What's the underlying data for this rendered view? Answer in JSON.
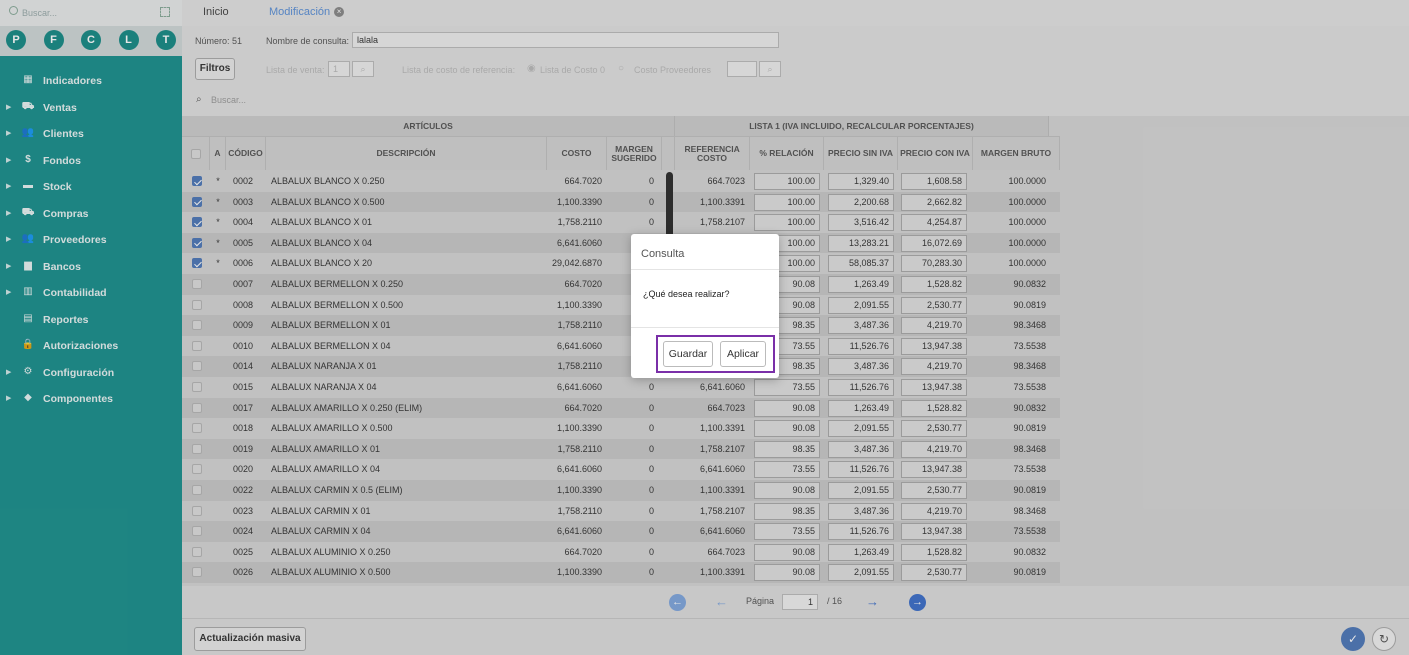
{
  "sidebar": {
    "search_placeholder": "Buscar...",
    "shortcuts": [
      "P",
      "F",
      "C",
      "L",
      "T"
    ],
    "items": [
      {
        "label": "Indicadores",
        "icon": "dashboard-icon",
        "glyph": "▦",
        "expandable": false
      },
      {
        "label": "Ventas",
        "icon": "cart-icon",
        "glyph": "⛟",
        "expandable": true
      },
      {
        "label": "Clientes",
        "icon": "users-icon",
        "glyph": "👥",
        "expandable": true
      },
      {
        "label": "Fondos",
        "icon": "dollar-icon",
        "glyph": "$",
        "expandable": true
      },
      {
        "label": "Stock",
        "icon": "box-icon",
        "glyph": "▬",
        "expandable": true
      },
      {
        "label": "Compras",
        "icon": "purchase-cart-icon",
        "glyph": "⛟",
        "expandable": true
      },
      {
        "label": "Proveedores",
        "icon": "suppliers-icon",
        "glyph": "👥",
        "expandable": true
      },
      {
        "label": "Bancos",
        "icon": "bank-icon",
        "glyph": "▆",
        "expandable": true
      },
      {
        "label": "Contabilidad",
        "icon": "ledger-icon",
        "glyph": "▥",
        "expandable": true
      },
      {
        "label": "Reportes",
        "icon": "report-icon",
        "glyph": "▤",
        "expandable": false
      },
      {
        "label": "Autorizaciones",
        "icon": "lock-icon",
        "glyph": "🔒",
        "expandable": false
      },
      {
        "label": "Configuración",
        "icon": "gears-icon",
        "glyph": "⚙",
        "expandable": true
      },
      {
        "label": "Componentes",
        "icon": "puzzle-icon",
        "glyph": "◆",
        "expandable": true
      }
    ]
  },
  "tabs": [
    {
      "label": "Inicio",
      "active": false
    },
    {
      "label": "Modificación",
      "active": true
    }
  ],
  "form": {
    "numero_label": "Número: 51",
    "nombre_label": "Nombre de consulta:",
    "nombre_value": "lalala",
    "filtros_label": "Filtros",
    "lista_venta_label": "Lista de venta:",
    "lista_venta_value": "1",
    "lista_costo_label": "Lista de costo de referencia:",
    "opt_lista_costo": "Lista de Costo 0",
    "opt_costo_prov": "Costo Proveedores",
    "search_placeholder": "Buscar..."
  },
  "table": {
    "group_articulos": "ARTÍCULOS",
    "group_lista": "LISTA 1 (IVA INCLUIDO, RECALCULAR PORCENTAJES)",
    "headers": {
      "a": "A",
      "codigo": "CÓDIGO",
      "descripcion": "DESCRIPCIÓN",
      "costo": "COSTO",
      "margen": "MARGEN SUGERIDO",
      "referencia": "REFERENCIA COSTO",
      "relacion": "% RELACIÓN",
      "sin_iva": "PRECIO SIN IVA",
      "con_iva": "PRECIO CON IVA",
      "margen_bruto": "MARGEN BRUTO"
    },
    "rows": [
      {
        "checked": true,
        "a": "*",
        "codigo": "0002",
        "desc": "ALBALUX BLANCO X 0.250",
        "costo": "664.7020",
        "margen": "0",
        "ref": "664.7023",
        "rel": "100.00",
        "siniva": "1,329.40",
        "coniva": "1,608.58",
        "mb": "100.0000"
      },
      {
        "checked": true,
        "a": "*",
        "codigo": "0003",
        "desc": "ALBALUX BLANCO X 0.500",
        "costo": "1,100.3390",
        "margen": "0",
        "ref": "1,100.3391",
        "rel": "100.00",
        "siniva": "2,200.68",
        "coniva": "2,662.82",
        "mb": "100.0000"
      },
      {
        "checked": true,
        "a": "*",
        "codigo": "0004",
        "desc": "ALBALUX BLANCO X 01",
        "costo": "1,758.2110",
        "margen": "0",
        "ref": "1,758.2107",
        "rel": "100.00",
        "siniva": "3,516.42",
        "coniva": "4,254.87",
        "mb": "100.0000"
      },
      {
        "checked": true,
        "a": "*",
        "codigo": "0005",
        "desc": "ALBALUX BLANCO X 04",
        "costo": "6,641.6060",
        "margen": "",
        "ref": "",
        "rel": "100.00",
        "siniva": "13,283.21",
        "coniva": "16,072.69",
        "mb": "100.0000"
      },
      {
        "checked": true,
        "a": "*",
        "codigo": "0006",
        "desc": "ALBALUX BLANCO X 20",
        "costo": "29,042.6870",
        "margen": "",
        "ref": "",
        "rel": "100.00",
        "siniva": "58,085.37",
        "coniva": "70,283.30",
        "mb": "100.0000"
      },
      {
        "checked": false,
        "a": "",
        "codigo": "0007",
        "desc": "ALBALUX BERMELLON X 0.250",
        "costo": "664.7020",
        "margen": "",
        "ref": "",
        "rel": "90.08",
        "siniva": "1,263.49",
        "coniva": "1,528.82",
        "mb": "90.0832"
      },
      {
        "checked": false,
        "a": "",
        "codigo": "0008",
        "desc": "ALBALUX BERMELLON X 0.500",
        "costo": "1,100.3390",
        "margen": "",
        "ref": "",
        "rel": "90.08",
        "siniva": "2,091.55",
        "coniva": "2,530.77",
        "mb": "90.0819"
      },
      {
        "checked": false,
        "a": "",
        "codigo": "0009",
        "desc": "ALBALUX BERMELLON X 01",
        "costo": "1,758.2110",
        "margen": "",
        "ref": "",
        "rel": "98.35",
        "siniva": "3,487.36",
        "coniva": "4,219.70",
        "mb": "98.3468"
      },
      {
        "checked": false,
        "a": "",
        "codigo": "0010",
        "desc": "ALBALUX BERMELLON X 04",
        "costo": "6,641.6060",
        "margen": "",
        "ref": "",
        "rel": "73.55",
        "siniva": "11,526.76",
        "coniva": "13,947.38",
        "mb": "73.5538"
      },
      {
        "checked": false,
        "a": "",
        "codigo": "0014",
        "desc": "ALBALUX NARANJA X 01",
        "costo": "1,758.2110",
        "margen": "",
        "ref": "",
        "rel": "98.35",
        "siniva": "3,487.36",
        "coniva": "4,219.70",
        "mb": "98.3468"
      },
      {
        "checked": false,
        "a": "",
        "codigo": "0015",
        "desc": "ALBALUX NARANJA X 04",
        "costo": "6,641.6060",
        "margen": "0",
        "ref": "6,641.6060",
        "rel": "73.55",
        "siniva": "11,526.76",
        "coniva": "13,947.38",
        "mb": "73.5538"
      },
      {
        "checked": false,
        "a": "",
        "codigo": "0017",
        "desc": "ALBALUX AMARILLO X 0.250 (ELIM)",
        "costo": "664.7020",
        "margen": "0",
        "ref": "664.7023",
        "rel": "90.08",
        "siniva": "1,263.49",
        "coniva": "1,528.82",
        "mb": "90.0832"
      },
      {
        "checked": false,
        "a": "",
        "codigo": "0018",
        "desc": "ALBALUX AMARILLO X 0.500",
        "costo": "1,100.3390",
        "margen": "0",
        "ref": "1,100.3391",
        "rel": "90.08",
        "siniva": "2,091.55",
        "coniva": "2,530.77",
        "mb": "90.0819"
      },
      {
        "checked": false,
        "a": "",
        "codigo": "0019",
        "desc": "ALBALUX AMARILLO X 01",
        "costo": "1,758.2110",
        "margen": "0",
        "ref": "1,758.2107",
        "rel": "98.35",
        "siniva": "3,487.36",
        "coniva": "4,219.70",
        "mb": "98.3468"
      },
      {
        "checked": false,
        "a": "",
        "codigo": "0020",
        "desc": "ALBALUX AMARILLO X 04",
        "costo": "6,641.6060",
        "margen": "0",
        "ref": "6,641.6060",
        "rel": "73.55",
        "siniva": "11,526.76",
        "coniva": "13,947.38",
        "mb": "73.5538"
      },
      {
        "checked": false,
        "a": "",
        "codigo": "0022",
        "desc": "ALBALUX CARMIN X 0.5 (ELIM)",
        "costo": "1,100.3390",
        "margen": "0",
        "ref": "1,100.3391",
        "rel": "90.08",
        "siniva": "2,091.55",
        "coniva": "2,530.77",
        "mb": "90.0819"
      },
      {
        "checked": false,
        "a": "",
        "codigo": "0023",
        "desc": "ALBALUX CARMIN X 01",
        "costo": "1,758.2110",
        "margen": "0",
        "ref": "1,758.2107",
        "rel": "98.35",
        "siniva": "3,487.36",
        "coniva": "4,219.70",
        "mb": "98.3468"
      },
      {
        "checked": false,
        "a": "",
        "codigo": "0024",
        "desc": "ALBALUX CARMIN X 04",
        "costo": "6,641.6060",
        "margen": "0",
        "ref": "6,641.6060",
        "rel": "73.55",
        "siniva": "11,526.76",
        "coniva": "13,947.38",
        "mb": "73.5538"
      },
      {
        "checked": false,
        "a": "",
        "codigo": "0025",
        "desc": "ALBALUX ALUMINIO X 0.250",
        "costo": "664.7020",
        "margen": "0",
        "ref": "664.7023",
        "rel": "90.08",
        "siniva": "1,263.49",
        "coniva": "1,528.82",
        "mb": "90.0832"
      },
      {
        "checked": false,
        "a": "",
        "codigo": "0026",
        "desc": "ALBALUX ALUMINIO X 0.500",
        "costo": "1,100.3390",
        "margen": "0",
        "ref": "1,100.3391",
        "rel": "90.08",
        "siniva": "2,091.55",
        "coniva": "2,530.77",
        "mb": "90.0819"
      }
    ]
  },
  "pager": {
    "label": "Página",
    "current": "1",
    "total": "/  16"
  },
  "footer": {
    "bulk_update_label": "Actualización masiva"
  },
  "modal": {
    "title": "Consulta",
    "message": "¿Qué desea realizar?",
    "save_label": "Guardar",
    "apply_label": "Aplicar"
  },
  "colors": {
    "sidebar_teal": "#1a8f8c",
    "accent_blue": "#4e78b8",
    "highlight_purple": "#7a2fa8"
  }
}
